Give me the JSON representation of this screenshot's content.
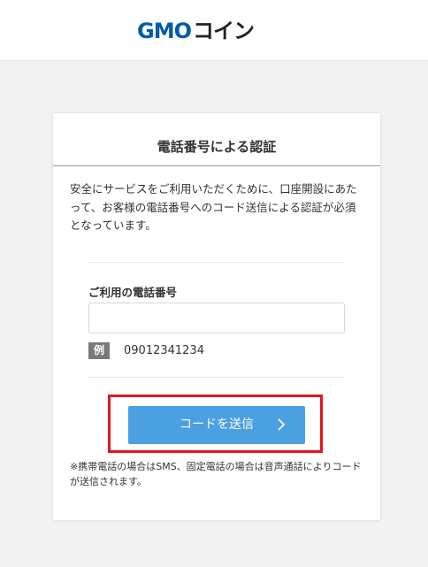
{
  "header": {
    "logo_gmo": "GMO",
    "logo_coin": "コイン"
  },
  "card": {
    "title": "電話番号による認証",
    "description": "安全にサービスをご利用いただくために、口座開設にあたって、お客様の電話番号へのコード送信による認証が必須となっています。",
    "phone_field": {
      "label": "ご利用の電話番号",
      "value": "",
      "placeholder": ""
    },
    "example": {
      "badge": "例",
      "value": "09012341234"
    },
    "send_button_label": "コードを送信",
    "note": "※携帯電話の場合はSMS、固定電話の場合は音声通話によりコードが送信されます。"
  },
  "colors": {
    "brand_blue": "#005bac",
    "button_blue": "#4aa0e0",
    "highlight_red": "#e8141e",
    "background": "#f2f2f2"
  },
  "icons": {
    "button_arrow": "chevron-right-icon"
  }
}
